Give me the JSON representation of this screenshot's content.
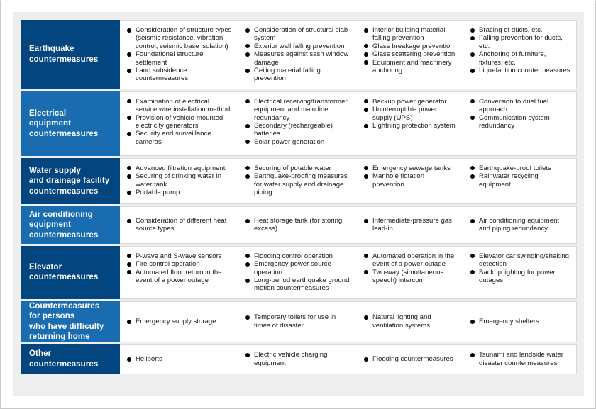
{
  "table": {
    "rows": [
      {
        "header": "Earthquake\ncountermeasures",
        "header_style": "navy",
        "columns": [
          [
            "Consideration of structure types (seismic resistance, vibration control, seismic base isolation)",
            "Foundational structure settlement",
            "Land subsidence countermeasures"
          ],
          [
            "Consideration of structural slab system",
            "Exterior wall falling prevention",
            "Measures against sash window damage",
            "Ceiling material falling prevention"
          ],
          [
            "Interior building material falling prevention",
            "Glass breakage prevention",
            "Glass scattering prevention",
            "Equipment and machinery anchoring"
          ],
          [
            "Bracing of ducts, etc.",
            "Falling prevention for ducts, etc.",
            "Anchoring of furniture, fixtures, etc.",
            "Liquefaction countermeasures"
          ]
        ]
      },
      {
        "header": "Electrical\nequipment\ncountermeasures",
        "header_style": "blue",
        "columns": [
          [
            "Examination of electrical service wire installation method",
            "Provision of vehicle-mounted electricity generators",
            "Security and surveillance cameras"
          ],
          [
            "Electrical receiving/transformer equipment and main line redundancy",
            "Secondary (rechargeable) batteries",
            "Solar power generation"
          ],
          [
            "Backup power generator",
            "Uninterruptible power supply (UPS)",
            "Lightning protection system"
          ],
          [
            "Conversion to duel fuel approach",
            "Communication system redundancy"
          ]
        ]
      },
      {
        "header": "Water supply\nand drainage facility\ncountermeasures",
        "header_style": "navy",
        "columns": [
          [
            "Advanced filtration equipment",
            "Securing of drinking water in water tank",
            "Portable pump"
          ],
          [
            "Securing of potable water",
            "Earthquake-proofing measures for water supply and drainage piping"
          ],
          [
            "Emergency sewage tanks",
            "Manhole flotation prevention"
          ],
          [
            "Earthquake-proof toilets",
            "Rainwater recycling equipment"
          ]
        ]
      },
      {
        "header": "Air conditioning\nequipment\ncountermeasures",
        "header_style": "blue",
        "columns": [
          [
            "Consideration of different heat source types"
          ],
          [
            "Heat storage tank (for storing excess)"
          ],
          [
            "Intermediate-pressure gas lead-in"
          ],
          [
            "Air conditioning equipment and piping redundancy"
          ]
        ]
      },
      {
        "header": "Elevator\ncountermeasures",
        "header_style": "navy",
        "columns": [
          [
            "P-wave and S-wave sensors",
            "Fire control operation",
            "Automated floor return in the event of a power outage"
          ],
          [
            "Flooding control operation",
            "Emergency power source operation",
            "Long-period earthquake ground motion countermeasures"
          ],
          [
            "Automated operation in the event of a power outage",
            "Two-way (simultaneous speech) intercom"
          ],
          [
            "Elevator car swinging/shaking detection",
            "Backup lighting for power outages"
          ]
        ]
      },
      {
        "header": "Countermeasures\nfor persons\nwho have difficulty\nreturning home",
        "header_style": "blue",
        "columns": [
          [
            "Emergency supply storage"
          ],
          [
            "Temporary toilets for use in times of disaster"
          ],
          [
            "Natural lighting and ventilation systems"
          ],
          [
            "Emergency shelters"
          ]
        ]
      },
      {
        "header": "Other\ncountermeasures",
        "header_style": "navy",
        "columns": [
          [
            "Heliports"
          ],
          [
            "Electric vehicle charging equipment"
          ],
          [
            "Flooding countermeasures"
          ],
          [
            "Tsunami and landside water disaster countermeasures"
          ]
        ]
      }
    ]
  },
  "colors": {
    "header_navy": "#03457e",
    "header_blue": "#1a6cb0",
    "panel_background": "#eeeeee",
    "cell_background": "#ffffff",
    "bullet": "#000000",
    "text": "#1a1a1a"
  }
}
